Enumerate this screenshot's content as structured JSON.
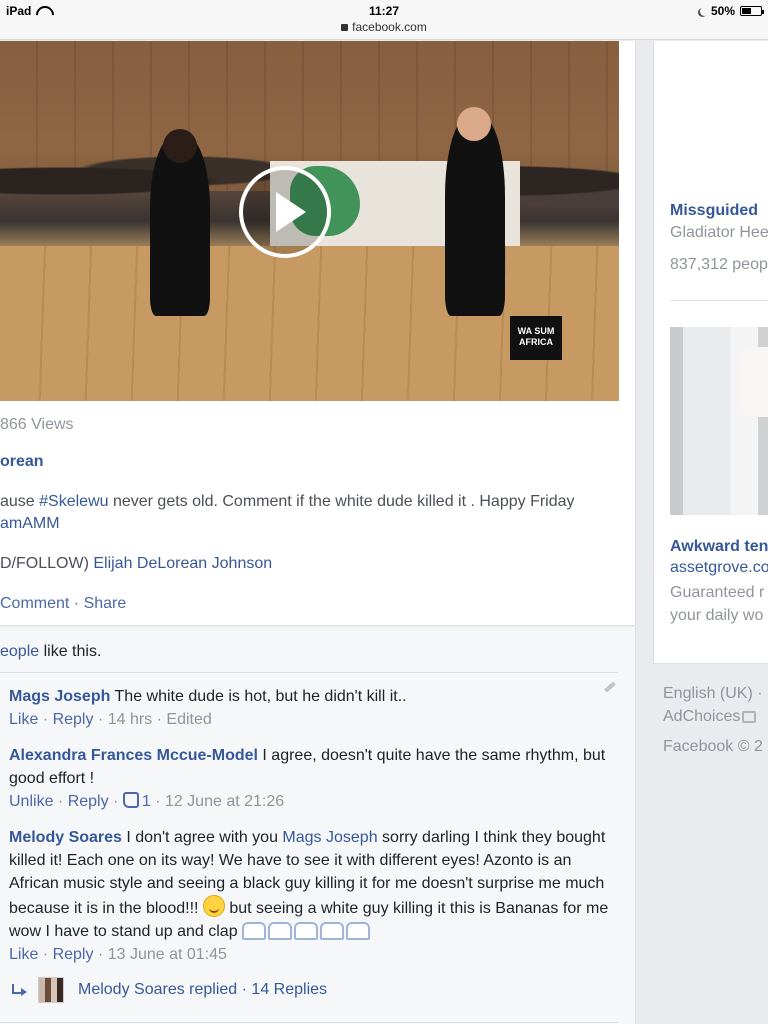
{
  "status_bar": {
    "device": "iPad",
    "time": "11:27",
    "url": "facebook.com",
    "battery": "50%",
    "battery_level": 0.5
  },
  "post": {
    "video_logo_text": "WA SUM AFRICA",
    "views": "866 Views",
    "author_fragment": "orean",
    "caption_pre": "ause ",
    "caption_tag": "#Skelewu",
    "caption_post": " never gets old. Comment if the white dude killed it . Happy Friday",
    "caption_tag2": "amAMM",
    "credit_pre": "D/FOLLOW) ",
    "credit_link": "Elijah DeLorean Johnson",
    "actions": {
      "comment": "Comment",
      "separator": " · ",
      "share": "Share"
    }
  },
  "comments_section": {
    "likes_link": "eople",
    "likes_text": " like this.",
    "comments": [
      {
        "name": "Mags Joseph",
        "text": " The white dude is hot, but he didn't kill it..",
        "like": "Like",
        "reply": "Reply",
        "time": "14 hrs",
        "edited": "Edited"
      },
      {
        "name": "Alexandra Frances Mccue-Model",
        "text": " I agree, doesn't quite have the same rhythm, but good effort !",
        "like": "Unlike",
        "reply": "Reply",
        "like_count": "1",
        "time": "12 June at 21:26"
      },
      {
        "name": "Melody Soares",
        "text_a": " I don't agree with you ",
        "mention": "Mags Joseph",
        "text_b": " sorry darling I think they bought killed it! Each one on its way! We have to see it with different eyes! Azonto is an African music style and seeing a black guy killing it for me doesn't surprise me much because it is in the blood!!! ",
        "text_c": " but seeing a white guy killing it this is Bananas for me wow I have to stand up and clap ",
        "like": "Like",
        "reply": "Reply",
        "time": "13 June at 01:45"
      }
    ],
    "replies": {
      "replier": "Melody Soares replied",
      "separator": " · ",
      "count": "14 Replies"
    }
  },
  "sidebar": {
    "ad1": {
      "title": "Missguided",
      "subtitle": "Gladiator Hee",
      "likes": "837,312 peop"
    },
    "ad2": {
      "title": "Awkward ten",
      "url": "assetgrove.co",
      "desc_line1": "Guaranteed r",
      "desc_line2": "your daily wo"
    },
    "footer": {
      "language": "English (UK) ·",
      "adchoices": "AdChoices",
      "copyright": "Facebook © 2"
    }
  }
}
